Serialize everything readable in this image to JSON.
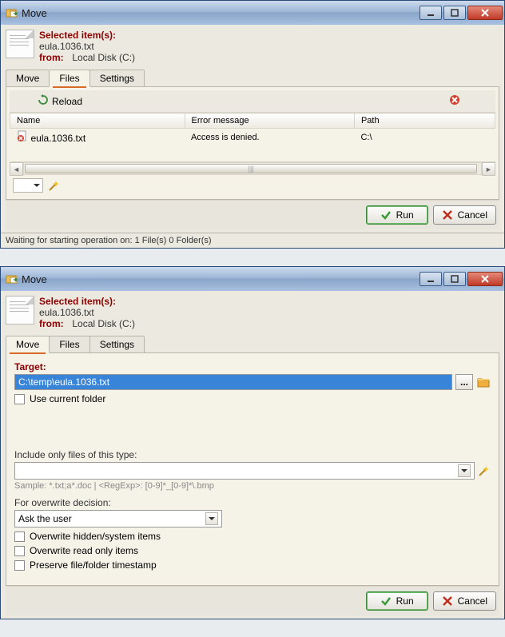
{
  "window1": {
    "title": "Move",
    "header": {
      "selected_label": "Selected item(s):",
      "selected_value": "eula.1036.txt",
      "from_label": "from:",
      "from_value": "Local Disk (C:)"
    },
    "tabs": {
      "move": "Move",
      "files": "Files",
      "settings": "Settings",
      "active": "files"
    },
    "toolbar": {
      "reload": "Reload"
    },
    "table": {
      "headers": {
        "name": "Name",
        "error": "Error message",
        "path": "Path"
      },
      "rows": [
        {
          "name": "eula.1036.txt",
          "error": "Access is denied.",
          "path": "C:\\"
        }
      ]
    },
    "scroll_mid": "|||",
    "footer": {
      "run": "Run",
      "cancel": "Cancel"
    },
    "status": "Waiting for starting operation on: 1 File(s) 0 Folder(s)"
  },
  "window2": {
    "title": "Move",
    "header": {
      "selected_label": "Selected item(s):",
      "selected_value": "eula.1036.txt",
      "from_label": "from:",
      "from_value": "Local Disk (C:)"
    },
    "tabs": {
      "move": "Move",
      "files": "Files",
      "settings": "Settings",
      "active": "move"
    },
    "target_label": "Target:",
    "target_value": "C:\\temp\\eula.1036.txt",
    "browse_btn": "...",
    "use_current": "Use current folder",
    "include_label": "Include only files of this type:",
    "include_value": "",
    "sample": "Sample: *.txt;a*.doc | <RegExp>: [0-9]*_[0-9]*\\.bmp",
    "overwrite_label": "For overwrite decision:",
    "overwrite_value": "Ask the user",
    "opts": {
      "hidden": "Overwrite hidden/system items",
      "readonly": "Overwrite read only items",
      "preserve": "Preserve file/folder timestamp"
    },
    "footer": {
      "run": "Run",
      "cancel": "Cancel"
    }
  }
}
